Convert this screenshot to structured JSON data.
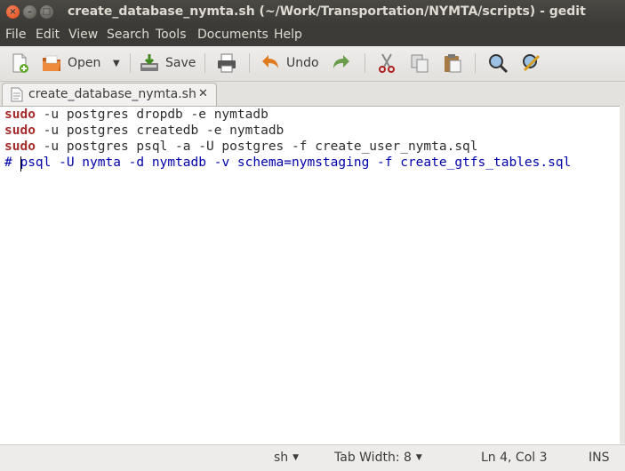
{
  "window": {
    "title": "create_database_nymta.sh (~/Work/Transportation/NYMTA/scripts) - gedit"
  },
  "menu": {
    "file": "File",
    "edit": "Edit",
    "view": "View",
    "search": "Search",
    "tools": "Tools",
    "documents": "Documents",
    "help": "Help"
  },
  "toolbar": {
    "open_label": "Open",
    "save_label": "Save",
    "undo_label": "Undo"
  },
  "tab": {
    "label": "create_database_nymta.sh",
    "close": "✕"
  },
  "editor": {
    "lines": [
      {
        "kw": "sudo",
        "rest": " -u postgres dropdb -e nymtadb"
      },
      {
        "kw": "sudo",
        "rest": " -u postgres createdb -e nymtadb"
      },
      {
        "kw": "sudo",
        "rest": " -u postgres psql -a -U postgres -f create_user_nymta.sql"
      },
      {
        "kw": "# ",
        "rest": "psql -U nymta -d nymtadb -v schema=nymstaging -f create_gtfs_tables.sql"
      }
    ]
  },
  "statusbar": {
    "language": "sh",
    "tab_width": "Tab Width:  8",
    "position": "Ln 4, Col 3",
    "mode": "INS"
  },
  "colors": {
    "keyword": "#a52a2a",
    "comment": "#0000aa",
    "titlebar": "#3c3b37"
  }
}
